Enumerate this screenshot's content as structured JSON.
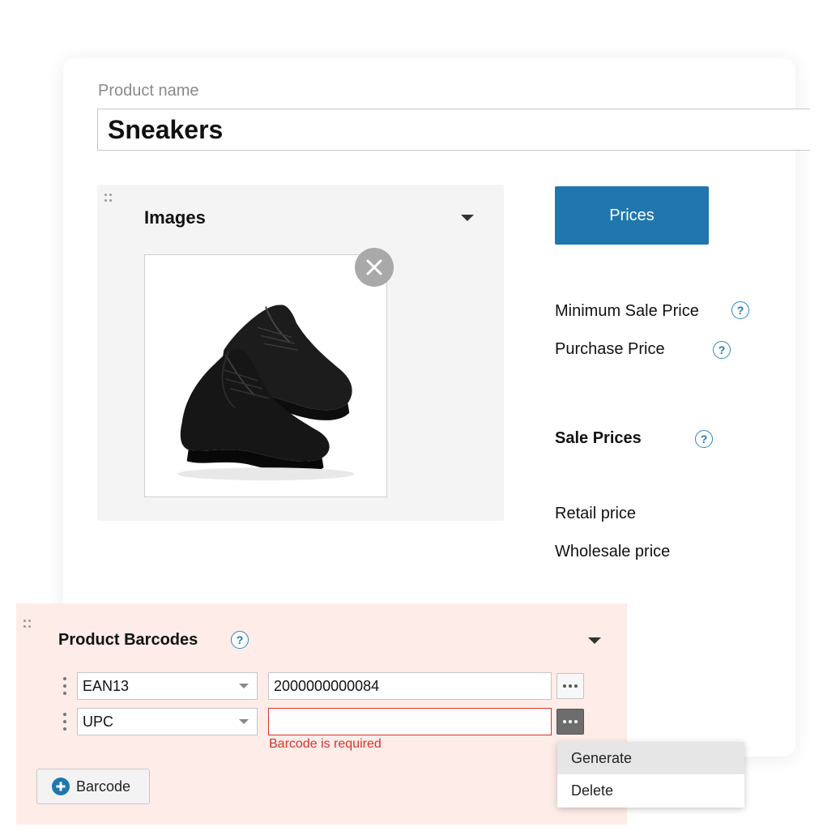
{
  "product": {
    "name_label": "Product name",
    "name_value": "Sneakers"
  },
  "images": {
    "title": "Images",
    "image_alt": "Black sneakers"
  },
  "prices": {
    "button_label": "Prices",
    "minimum_sale_price": "Minimum Sale Price",
    "purchase_price": "Purchase Price",
    "sale_prices_title": "Sale Prices",
    "retail_price": "Retail price",
    "wholesale_price": "Wholesale price",
    "help_glyph": "?"
  },
  "barcodes": {
    "title": "Product Barcodes",
    "rows": [
      {
        "type": "EAN13",
        "value": "2000000000084"
      },
      {
        "type": "UPC",
        "value": ""
      }
    ],
    "error_message": "Barcode is required",
    "add_button_label": "Barcode"
  },
  "context_menu": {
    "items": [
      "Generate",
      "Delete"
    ]
  },
  "colors": {
    "accent": "#1f77ad",
    "error": "#d9322c",
    "barcode_panel_bg": "#fdece8",
    "images_panel_bg": "#f4f4f4"
  }
}
